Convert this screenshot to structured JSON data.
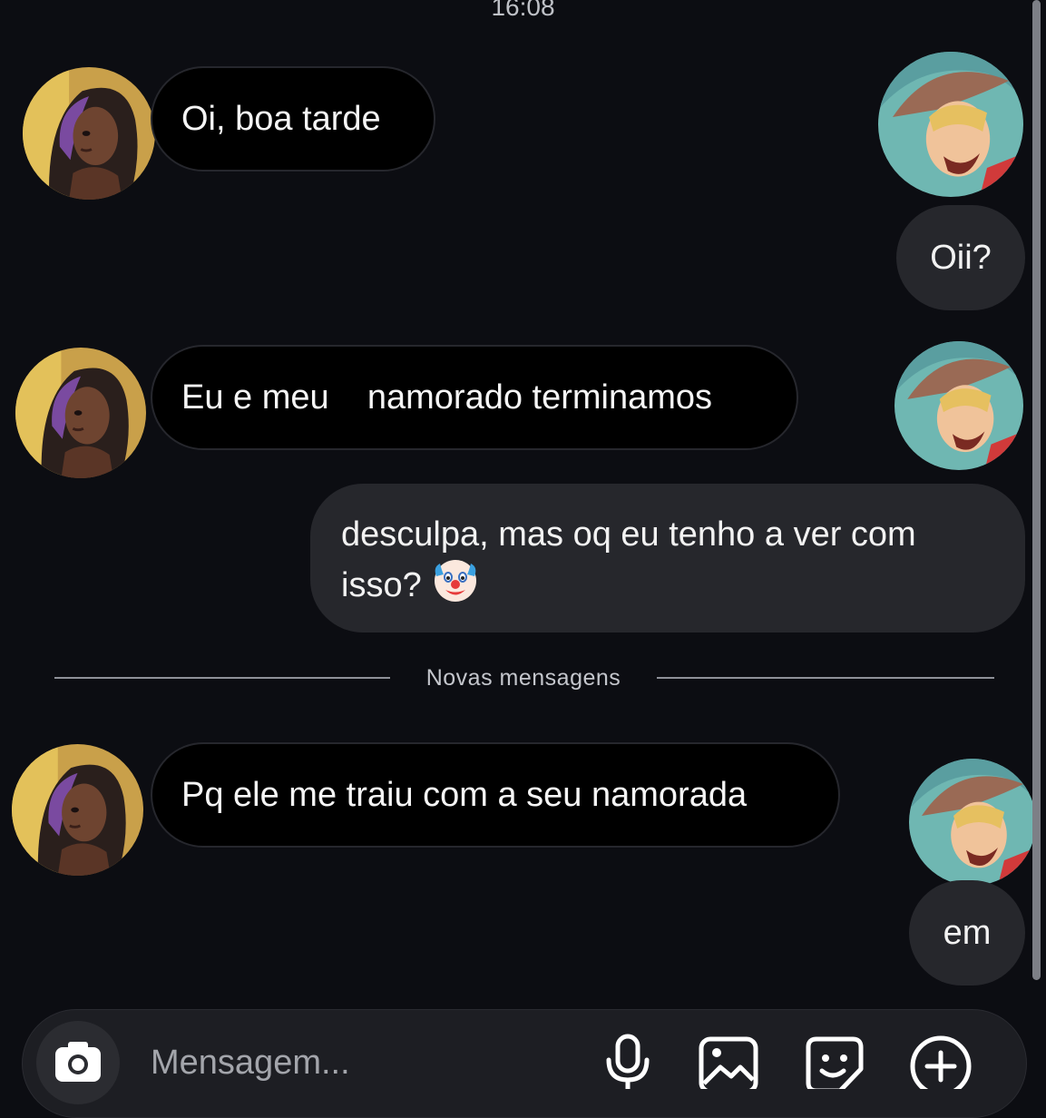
{
  "header": {
    "time": "16:08"
  },
  "messages": [
    {
      "side": "in",
      "text": "Oi, boa tarde"
    },
    {
      "side": "out",
      "text": "Oii?"
    },
    {
      "side": "in",
      "text": "Eu e meu    namorado terminamos"
    },
    {
      "side": "out",
      "line1": "desculpa, mas oq eu tenho a ver com",
      "line2": "isso?",
      "emoji": "clown-face-emoji"
    },
    {
      "side": "in",
      "text": "Pq ele me traiu com a seu namorada"
    },
    {
      "side": "out",
      "text": "em"
    }
  ],
  "separator": {
    "label": "Novas mensagens"
  },
  "composer": {
    "placeholder": "Mensagem...",
    "icons": [
      "camera-icon",
      "microphone-icon",
      "gallery-icon",
      "sticker-icon",
      "plus-icon"
    ]
  },
  "avatars": {
    "contact": "woman-avatar",
    "me": "cowboy-avatar"
  },
  "colors": {
    "background": "#0c0d12",
    "incoming": "#000000",
    "outgoing": "#26272c",
    "input": "#1d1e23"
  }
}
